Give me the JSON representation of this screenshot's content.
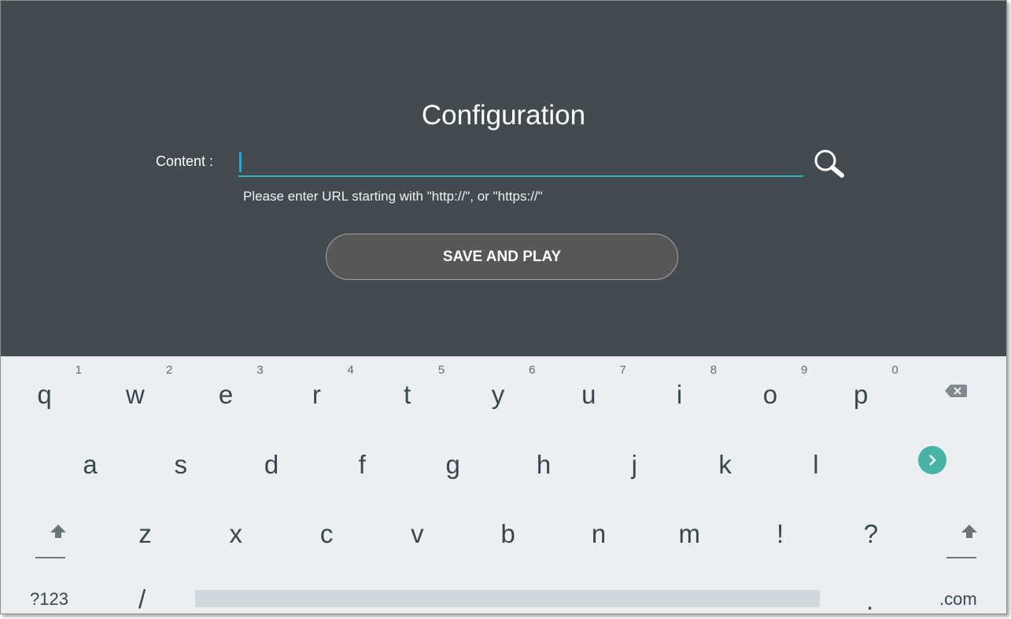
{
  "config": {
    "title": "Configuration",
    "content_label": "Content :",
    "content_value": "",
    "hint": "Please enter URL starting with \"http://\", or \"https://\"",
    "save_button": "SAVE AND PLAY",
    "search_icon": "search-icon"
  },
  "keyboard": {
    "row1": [
      {
        "char": "q",
        "hint": "1"
      },
      {
        "char": "w",
        "hint": "2"
      },
      {
        "char": "e",
        "hint": "3"
      },
      {
        "char": "r",
        "hint": "4"
      },
      {
        "char": "t",
        "hint": "5"
      },
      {
        "char": "y",
        "hint": "6"
      },
      {
        "char": "u",
        "hint": "7"
      },
      {
        "char": "i",
        "hint": "8"
      },
      {
        "char": "o",
        "hint": "9"
      },
      {
        "char": "p",
        "hint": "0"
      }
    ],
    "row2": [
      "a",
      "s",
      "d",
      "f",
      "g",
      "h",
      "j",
      "k",
      "l"
    ],
    "row3": [
      "z",
      "x",
      "c",
      "v",
      "b",
      "n",
      "m",
      "!",
      "?"
    ],
    "symbols_key": "?123",
    "slash_key": "/",
    "period_key": ".",
    "dotcom_key": ".com",
    "backspace_icon": "backspace-icon",
    "enter_icon": "chevron-right-icon",
    "shift_icon": "shift-arrow-icon",
    "colors": {
      "enter": "#46b3a5",
      "accent": "#2bb5c6",
      "panel": "#424b50",
      "keyboard": "#eceff1"
    }
  }
}
